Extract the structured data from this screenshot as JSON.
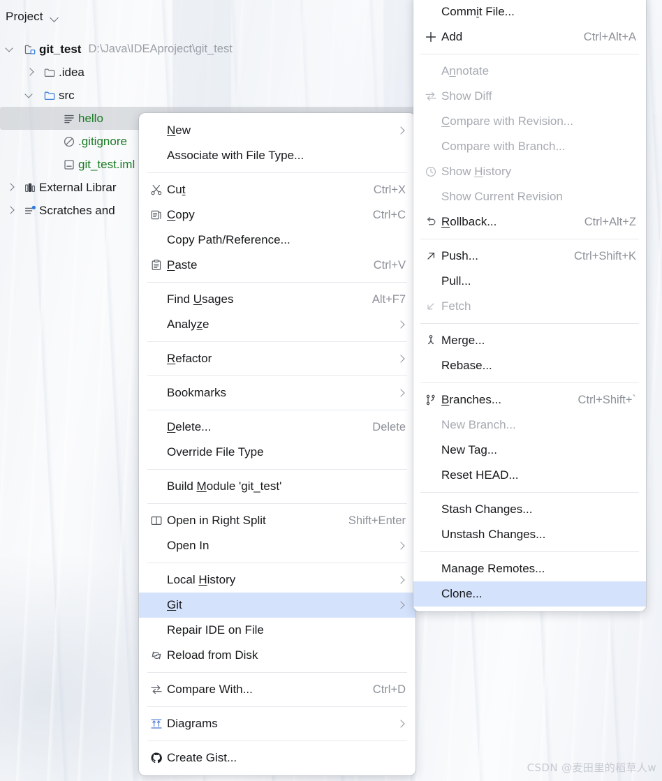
{
  "window": {
    "background_color": "#eef1f5"
  },
  "project_panel": {
    "title": "Project",
    "title_chevron_icon": "chevron-down-icon",
    "tree": [
      {
        "label": "git_test",
        "path": "D:\\Java\\IDEAproject\\git_test",
        "icon": "project-module-icon",
        "twisty": "down",
        "indent": 0,
        "bold": true
      },
      {
        "label": ".idea",
        "path": "",
        "icon": "folder-icon",
        "twisty": "right",
        "indent": 1,
        "bold": false
      },
      {
        "label": "src",
        "path": "",
        "icon": "folder-blue-icon",
        "twisty": "down",
        "indent": 1,
        "bold": false
      },
      {
        "label": "hello",
        "path": "",
        "icon": "text-file-icon",
        "twisty": "none",
        "indent": 2,
        "green": true,
        "selected": true
      },
      {
        "label": ".gitignore",
        "path": "",
        "icon": "gitignore-icon",
        "twisty": "none",
        "indent": 2,
        "green": true
      },
      {
        "label": "git_test.iml",
        "path": "",
        "icon": "iml-file-icon",
        "twisty": "none",
        "indent": 2,
        "green": true
      },
      {
        "label": "External Librar",
        "path": "",
        "icon": "library-icon",
        "twisty": "right",
        "indent": 0,
        "bold": false
      },
      {
        "label": "Scratches and",
        "path": "",
        "icon": "scratches-icon",
        "twisty": "right",
        "indent": 0,
        "bold": false
      }
    ]
  },
  "context_menu": {
    "items": [
      {
        "label": "New",
        "mnemonic": "N",
        "shortcut": "",
        "icon": "",
        "arrow": true
      },
      {
        "label": "Associate with File Type...",
        "mnemonic": "",
        "shortcut": "",
        "icon": "",
        "arrow": false
      },
      {
        "separator": true
      },
      {
        "label": "Cut",
        "mnemonic": "t",
        "shortcut": "Ctrl+X",
        "icon": "scissors-icon",
        "arrow": false
      },
      {
        "label": "Copy",
        "mnemonic": "C",
        "shortcut": "Ctrl+C",
        "icon": "copy-icon",
        "arrow": false
      },
      {
        "label": "Copy Path/Reference...",
        "mnemonic": "",
        "shortcut": "",
        "icon": "",
        "arrow": false
      },
      {
        "label": "Paste",
        "mnemonic": "P",
        "shortcut": "Ctrl+V",
        "icon": "paste-icon",
        "arrow": false
      },
      {
        "separator": true
      },
      {
        "label": "Find Usages",
        "mnemonic": "U",
        "shortcut": "Alt+F7",
        "icon": "",
        "arrow": false
      },
      {
        "label": "Analyze",
        "mnemonic": "z",
        "shortcut": "",
        "icon": "",
        "arrow": true
      },
      {
        "separator": true
      },
      {
        "label": "Refactor",
        "mnemonic": "R",
        "shortcut": "",
        "icon": "",
        "arrow": true
      },
      {
        "separator": true
      },
      {
        "label": "Bookmarks",
        "mnemonic": "",
        "shortcut": "",
        "icon": "",
        "arrow": true
      },
      {
        "separator": true
      },
      {
        "label": "Delete...",
        "mnemonic": "D",
        "shortcut": "Delete",
        "icon": "",
        "arrow": false
      },
      {
        "label": "Override File Type",
        "mnemonic": "",
        "shortcut": "",
        "icon": "",
        "arrow": false
      },
      {
        "separator": true
      },
      {
        "label": "Build Module 'git_test'",
        "mnemonic": "M",
        "shortcut": "",
        "icon": "",
        "arrow": false
      },
      {
        "separator": true
      },
      {
        "label": "Open in Right Split",
        "mnemonic": "",
        "shortcut": "Shift+Enter",
        "icon": "split-icon",
        "arrow": false
      },
      {
        "label": "Open In",
        "mnemonic": "",
        "shortcut": "",
        "icon": "",
        "arrow": true
      },
      {
        "separator": true
      },
      {
        "label": "Local History",
        "mnemonic": "H",
        "shortcut": "",
        "icon": "",
        "arrow": true
      },
      {
        "label": "Git",
        "mnemonic": "G",
        "shortcut": "",
        "icon": "",
        "arrow": true,
        "highlighted": true
      },
      {
        "label": "Repair IDE on File",
        "mnemonic": "",
        "shortcut": "",
        "icon": "",
        "arrow": false
      },
      {
        "label": "Reload from Disk",
        "mnemonic": "",
        "shortcut": "",
        "icon": "reload-icon",
        "arrow": false
      },
      {
        "separator": true
      },
      {
        "label": "Compare With...",
        "mnemonic": "",
        "shortcut": "Ctrl+D",
        "icon": "compare-icon",
        "arrow": false
      },
      {
        "separator": true
      },
      {
        "label": "Diagrams",
        "mnemonic": "",
        "shortcut": "",
        "icon": "diagrams-icon",
        "arrow": true
      },
      {
        "separator": true
      },
      {
        "label": "Create Gist...",
        "mnemonic": "",
        "shortcut": "",
        "icon": "github-icon",
        "arrow": false
      }
    ]
  },
  "git_submenu": {
    "items": [
      {
        "label": "Commit File...",
        "mnemonic": "i",
        "shortcut": "",
        "icon": "",
        "disabled": false
      },
      {
        "label": "Add",
        "mnemonic": "",
        "shortcut": "Ctrl+Alt+A",
        "icon": "plus-icon",
        "disabled": false
      },
      {
        "separator": true
      },
      {
        "label": "Annotate",
        "mnemonic": "n",
        "shortcut": "",
        "icon": "",
        "disabled": true
      },
      {
        "label": "Show Diff",
        "mnemonic": "",
        "shortcut": "",
        "icon": "compare-icon",
        "disabled": true
      },
      {
        "label": "Compare with Revision...",
        "mnemonic": "C",
        "shortcut": "",
        "icon": "",
        "disabled": true
      },
      {
        "label": "Compare with Branch...",
        "mnemonic": "",
        "shortcut": "",
        "icon": "",
        "disabled": true
      },
      {
        "label": "Show History",
        "mnemonic": "H",
        "shortcut": "",
        "icon": "clock-icon",
        "disabled": true
      },
      {
        "label": "Show Current Revision",
        "mnemonic": "",
        "shortcut": "",
        "icon": "",
        "disabled": true
      },
      {
        "label": "Rollback...",
        "mnemonic": "R",
        "shortcut": "Ctrl+Alt+Z",
        "icon": "rollback-icon",
        "disabled": false
      },
      {
        "separator": true
      },
      {
        "label": "Push...",
        "mnemonic": "",
        "shortcut": "Ctrl+Shift+K",
        "icon": "push-icon",
        "disabled": false
      },
      {
        "label": "Pull...",
        "mnemonic": "",
        "shortcut": "",
        "icon": "",
        "disabled": false
      },
      {
        "label": "Fetch",
        "mnemonic": "",
        "shortcut": "",
        "icon": "fetch-icon",
        "disabled": true
      },
      {
        "separator": true
      },
      {
        "label": "Merge...",
        "mnemonic": "",
        "shortcut": "",
        "icon": "merge-icon",
        "disabled": false
      },
      {
        "label": "Rebase...",
        "mnemonic": "",
        "shortcut": "",
        "icon": "",
        "disabled": false
      },
      {
        "separator": true
      },
      {
        "label": "Branches...",
        "mnemonic": "B",
        "shortcut": "Ctrl+Shift+`",
        "icon": "branch-icon",
        "disabled": false
      },
      {
        "label": "New Branch...",
        "mnemonic": "",
        "shortcut": "",
        "icon": "",
        "disabled": true
      },
      {
        "label": "New Tag...",
        "mnemonic": "",
        "shortcut": "",
        "icon": "",
        "disabled": false
      },
      {
        "label": "Reset HEAD...",
        "mnemonic": "",
        "shortcut": "",
        "icon": "",
        "disabled": false
      },
      {
        "separator": true
      },
      {
        "label": "Stash Changes...",
        "mnemonic": "",
        "shortcut": "",
        "icon": "",
        "disabled": false
      },
      {
        "label": "Unstash Changes...",
        "mnemonic": "",
        "shortcut": "",
        "icon": "",
        "disabled": false
      },
      {
        "separator": true
      },
      {
        "label": "Manage Remotes...",
        "mnemonic": "",
        "shortcut": "",
        "icon": "",
        "disabled": false
      },
      {
        "label": "Clone...",
        "mnemonic": "",
        "shortcut": "",
        "icon": "",
        "disabled": false,
        "highlighted": true
      }
    ]
  },
  "watermark": {
    "text": "CSDN @麦田里的稻草人w"
  },
  "colors": {
    "highlight": "#d5e2fc",
    "tree_selected": "#c8cbd0",
    "git_added_text": "#1a7a22",
    "shortcut_text": "#8d9199",
    "disabled_text": "#a7abb2"
  }
}
